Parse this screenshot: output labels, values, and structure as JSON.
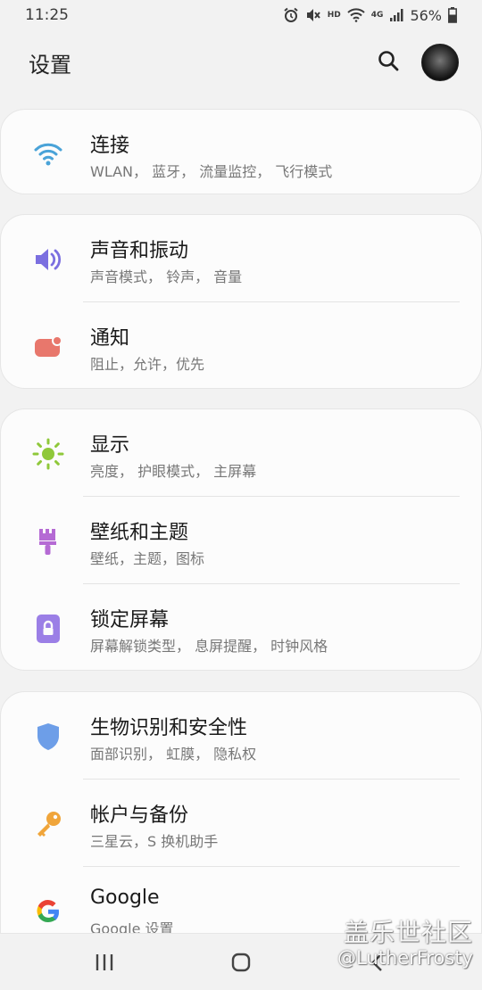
{
  "status_bar": {
    "time": "11:25",
    "hd": "HD",
    "network": "4G",
    "battery": "56%"
  },
  "header": {
    "title": "设置"
  },
  "groups": [
    {
      "items": [
        {
          "title": "连接",
          "subtitle": "WLAN， 蓝牙， 流量监控， 飞行模式",
          "icon": "wifi-icon",
          "color": "#4aa3d8"
        }
      ]
    },
    {
      "items": [
        {
          "title": "声音和振动",
          "subtitle": "声音模式， 铃声， 音量",
          "icon": "volume-icon",
          "color": "#7b6fe0"
        },
        {
          "title": "通知",
          "subtitle": "阻止，允许，优先",
          "icon": "notification-icon",
          "color": "#e8776c"
        }
      ]
    },
    {
      "items": [
        {
          "title": "显示",
          "subtitle": "亮度， 护眼模式， 主屏幕",
          "icon": "brightness-icon",
          "color": "#8fc83a"
        },
        {
          "title": "壁纸和主题",
          "subtitle": "壁纸，主题，图标",
          "icon": "paintbrush-icon",
          "color": "#b56ad4"
        },
        {
          "title": "锁定屏幕",
          "subtitle": "屏幕解锁类型， 息屏提醒， 时钟风格",
          "icon": "lock-icon",
          "color": "#9b7fe6"
        }
      ]
    },
    {
      "items": [
        {
          "title": "生物识别和安全性",
          "subtitle": "面部识别， 虹膜， 隐私权",
          "icon": "shield-icon",
          "color": "#6d9ee8"
        },
        {
          "title": "帐户与备份",
          "subtitle": "三星云，S 换机助手",
          "icon": "key-icon",
          "color": "#f0a53a"
        },
        {
          "title": "Google",
          "subtitle": "Google 设置",
          "icon": "google-icon",
          "color": "#4285f4"
        }
      ]
    }
  ],
  "watermark": {
    "line1": "盖乐世社区",
    "line2": "@LutherFrosty"
  }
}
